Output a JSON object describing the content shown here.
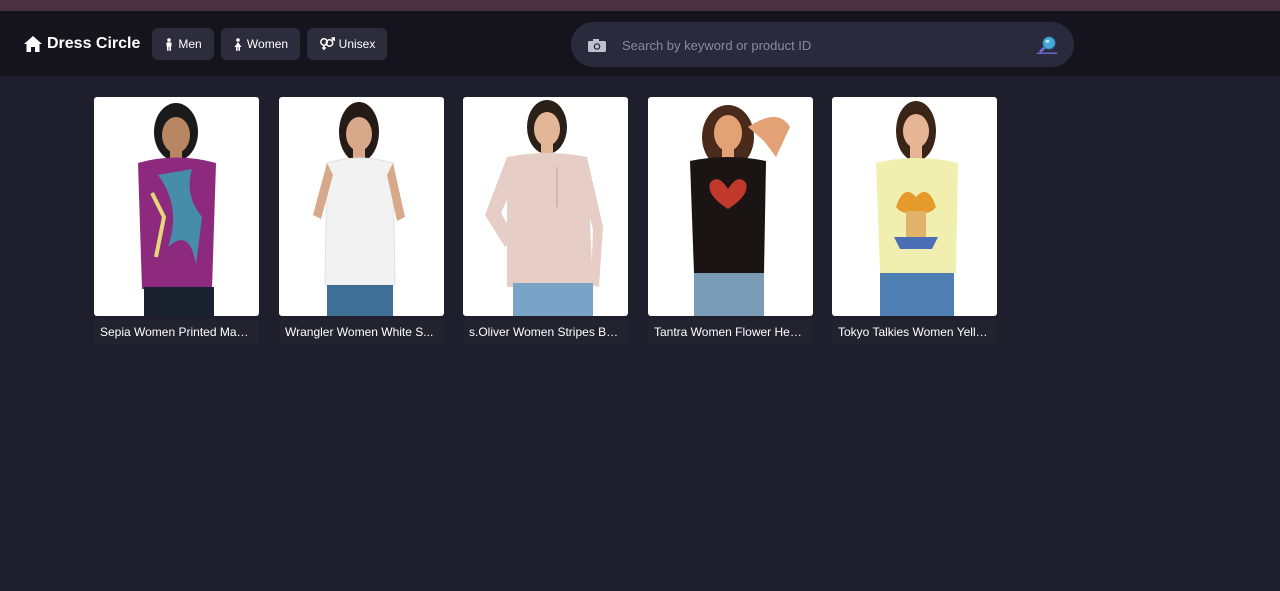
{
  "header": {
    "brand": "Dress Circle",
    "nav": [
      {
        "label": "Men",
        "icon": "male-icon"
      },
      {
        "label": "Women",
        "icon": "female-icon"
      },
      {
        "label": "Unisex",
        "icon": "gender-icon"
      }
    ],
    "search": {
      "placeholder": "Search by keyword or product ID",
      "value": ""
    }
  },
  "products": [
    {
      "name": "Sepia Women Printed Mag...",
      "shirt_color": "#8e2a7e",
      "accent": "#3a9fb0"
    },
    {
      "name": "Wrangler Women White S...",
      "shirt_color": "#f2f2f2",
      "accent": "#e0e0e0"
    },
    {
      "name": "s.Oliver Women Stripes Bei...",
      "shirt_color": "#e6cdc6",
      "accent": "#d8bcb4"
    },
    {
      "name": "Tantra Women Flower Hear...",
      "shirt_color": "#1a1414",
      "accent": "#c0392b"
    },
    {
      "name": "Tokyo Talkies Women Yello...",
      "shirt_color": "#f1efb0",
      "accent": "#e59a2a"
    }
  ],
  "colors": {
    "background": "#1f1e2d",
    "header": "#15141c",
    "button": "#2d2c3d",
    "search": "#2a2a3d"
  }
}
